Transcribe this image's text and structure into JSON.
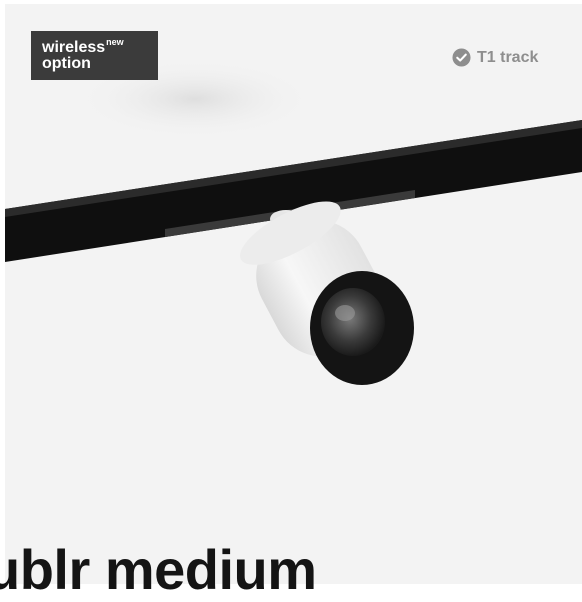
{
  "badge": {
    "line1": "wireless",
    "superscript": "new",
    "line2": "option"
  },
  "track_tag": {
    "icon": "check-circle-icon",
    "label": "T1 track"
  },
  "product": {
    "title": "ublr medium",
    "image_alt": "track spotlight"
  },
  "colors": {
    "card_background": "#f3f3f3",
    "badge_background": "#3b3b3b",
    "tag_text": "#8e8e8e",
    "title_text": "#141414"
  }
}
